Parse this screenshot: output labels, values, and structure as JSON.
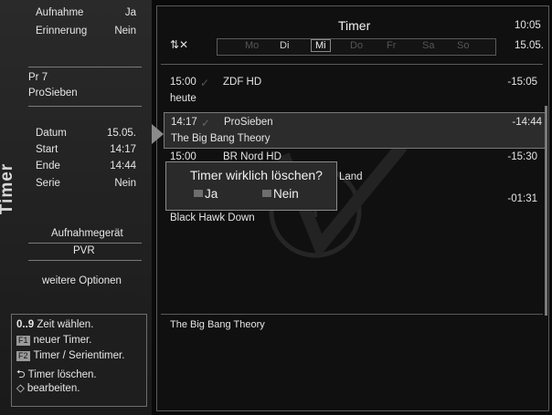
{
  "sidebar": {
    "vertical_title": "Timer",
    "recording_label": "Aufnahme",
    "recording_value": "Ja",
    "reminder_label": "Erinnerung",
    "reminder_value": "Nein",
    "program_number": "Pr 7",
    "channel_name": "ProSieben",
    "date_label": "Datum",
    "date_value": "15.05.",
    "start_label": "Start",
    "start_value": "14:17",
    "end_label": "Ende",
    "end_value": "14:44",
    "series_label": "Serie",
    "series_value": "Nein",
    "device_label": "Aufnahmegerät",
    "device_value": "PVR",
    "more_options": "weitere Optionen"
  },
  "help": {
    "line1_key": "0..9",
    "line1_text": "Zeit wählen.",
    "line2_key": "F1",
    "line2_text": "neuer Timer.",
    "line3_key": "F2",
    "line3_text": "Timer / Serientimer.",
    "line4_text": "Timer löschen.",
    "line5_text": "bearbeiten."
  },
  "header": {
    "title": "Timer",
    "clock": "10:05",
    "date": "15.05.",
    "days": [
      "Mo",
      "Di",
      "Mi",
      "Do",
      "Fr",
      "Sa",
      "So"
    ],
    "selected_day": "Mi"
  },
  "timers": [
    {
      "start": "15:00",
      "channel": "ZDF HD",
      "end": "-15:05",
      "subtitle": "heute"
    },
    {
      "start": "14:17",
      "channel": "ProSieben",
      "end": "-14:44",
      "subtitle": "The Big Bang Theory"
    },
    {
      "start": "15:00",
      "channel": "BR Nord HD",
      "channel_suffix": "Land",
      "end": "-15:30"
    },
    {
      "end": "-01:31",
      "subtitle": "Black Hawk Down"
    }
  ],
  "dialog": {
    "question": "Timer wirklich löschen?",
    "yes": "Ja",
    "no": "Nein"
  },
  "info": {
    "title": "The Big Bang Theory"
  }
}
